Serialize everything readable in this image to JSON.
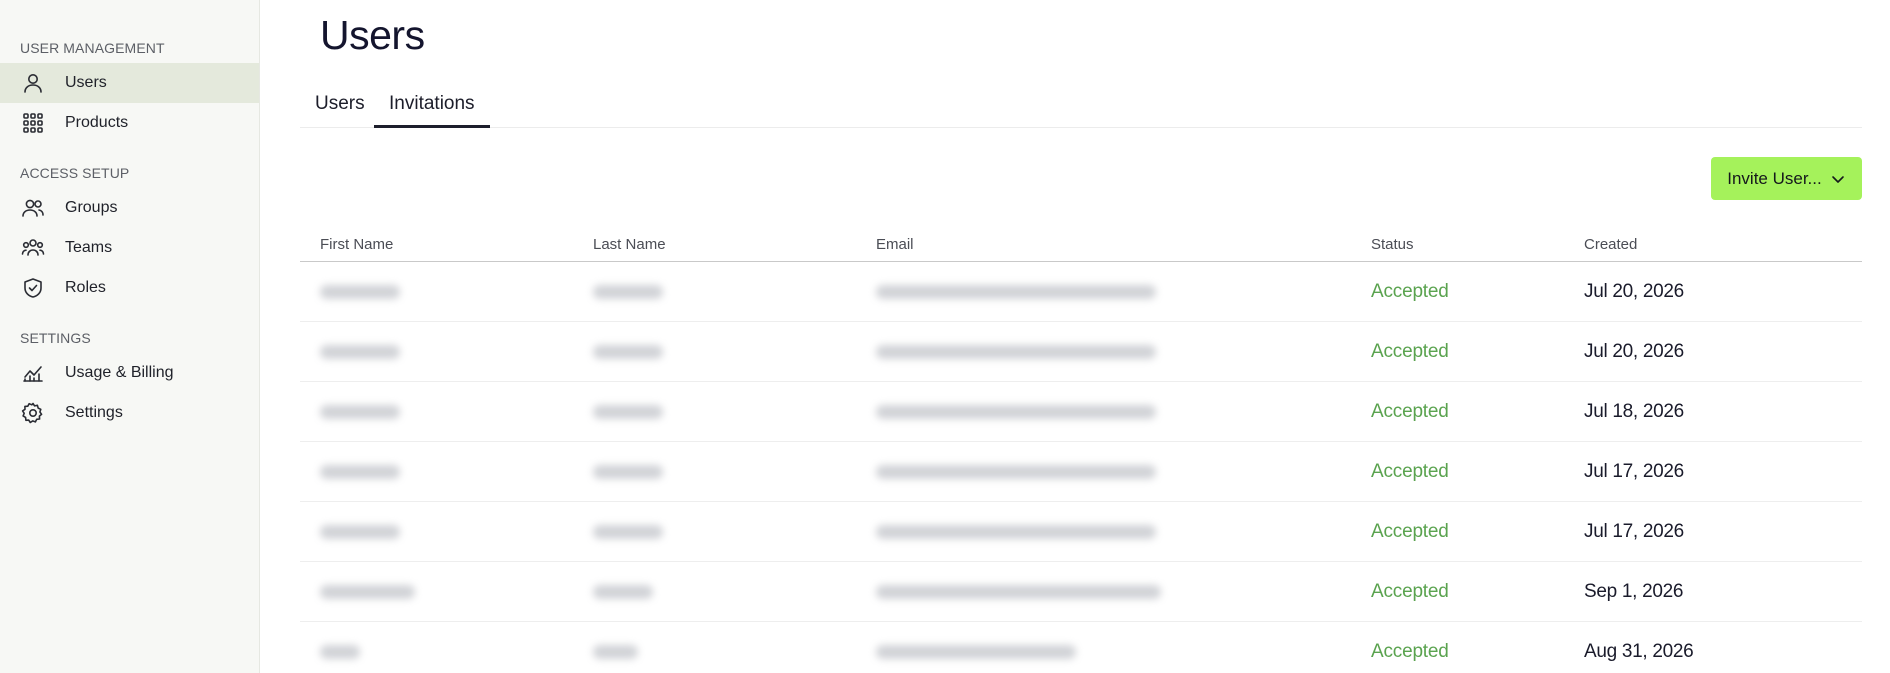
{
  "sidebar": {
    "sections": [
      {
        "heading": "USER MANAGEMENT",
        "items": [
          {
            "label": "Users",
            "icon": "user-icon",
            "active": true
          },
          {
            "label": "Products",
            "icon": "grid-icon",
            "active": false
          }
        ]
      },
      {
        "heading": "ACCESS SETUP",
        "items": [
          {
            "label": "Groups",
            "icon": "group-icon",
            "active": false
          },
          {
            "label": "Teams",
            "icon": "team-icon",
            "active": false
          },
          {
            "label": "Roles",
            "icon": "shield-icon",
            "active": false
          }
        ]
      },
      {
        "heading": "SETTINGS",
        "items": [
          {
            "label": "Usage & Billing",
            "icon": "chart-icon",
            "active": false
          },
          {
            "label": "Settings",
            "icon": "gear-icon",
            "active": false
          }
        ]
      }
    ]
  },
  "main": {
    "title": "Users",
    "tabs": [
      {
        "label": "Users",
        "active": false
      },
      {
        "label": "Invitations",
        "active": true
      }
    ],
    "invite_button": {
      "label": "Invite User...",
      "icon": "chevron-down-icon",
      "color": "#a5f25b"
    }
  },
  "table": {
    "columns": [
      "First Name",
      "Last Name",
      "Email",
      "Status",
      "Created"
    ],
    "rows": [
      {
        "status": "Accepted",
        "created": "Jul 20, 2026"
      },
      {
        "status": "Accepted",
        "created": "Jul 20, 2026"
      },
      {
        "status": "Accepted",
        "created": "Jul 18, 2026"
      },
      {
        "status": "Accepted",
        "created": "Jul 17, 2026"
      },
      {
        "status": "Accepted",
        "created": "Jul 17, 2026"
      },
      {
        "status": "Accepted",
        "created": "Sep 1, 2026"
      },
      {
        "status": "Accepted",
        "created": "Aug 31, 2026"
      }
    ]
  },
  "colors": {
    "status_accepted": "#5aa34f",
    "active_nav_bg": "#e4e9dc",
    "sidebar_bg": "#f7f8f5"
  }
}
